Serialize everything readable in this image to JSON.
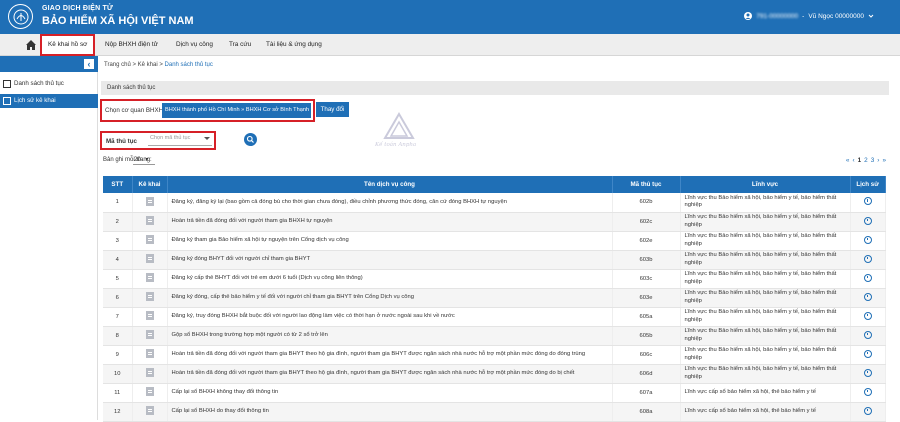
{
  "header": {
    "brand_line1": "GIAO DỊCH ĐIỆN TỬ",
    "brand_line2": "BẢO HIỂM XÃ HỘI VIỆT NAM",
    "user_code": "791-00000000",
    "user_name": "Vũ Ngọc 00000000"
  },
  "nav": {
    "items": [
      {
        "label": "Kê khai hồ sơ"
      },
      {
        "label": "Nộp BHXH điện tử"
      },
      {
        "label": "Dịch vụ công"
      },
      {
        "label": "Tra cứu"
      },
      {
        "label": "Tài liệu & ứng dụng"
      }
    ]
  },
  "sidebar": {
    "items": [
      {
        "label": "Danh sách thủ tục"
      },
      {
        "label": "Lịch sử kê khai"
      }
    ]
  },
  "breadcrumb": {
    "home": "Trang chủ",
    "sep": ">",
    "level1": "Kê khai",
    "current": "Danh sách thủ tục"
  },
  "section_title": "Danh sách thủ tục",
  "filters": {
    "agency_label": "Chọn cơ quan BHXH",
    "agency_value": "BHXH thành phố Hồ Chí Minh » BHXH Cơ sở Bình Thạnh",
    "change_button": "Thay đổi",
    "code_label": "Mã thủ tục",
    "code_placeholder": "Chọn mã thủ tục"
  },
  "watermark_text": "Kế toán Anpha",
  "paging": {
    "page_size_label": "Bản ghi mỗi trang:",
    "page_size": "20",
    "first": "«",
    "prev": "‹",
    "pages": [
      "1",
      "2",
      "3"
    ],
    "next": "›",
    "last": "»"
  },
  "table": {
    "headers": {
      "stt": "STT",
      "kekhai": "Kê khai",
      "name": "Tên dịch vụ công",
      "code": "Mã thủ tục",
      "field": "Lĩnh vực",
      "history": "Lịch sử"
    },
    "rows": [
      {
        "stt": "1",
        "name": "Đăng ký, đăng ký lại (bao gồm cả đóng bù cho thời gian chưa đóng), điều chỉnh phương thức đóng, căn cứ đóng BHXH tự nguyện",
        "code": "602b",
        "field": "Lĩnh vực thu Bảo hiểm xã hội, bảo hiểm y tế, bảo hiểm thất nghiệp"
      },
      {
        "stt": "2",
        "name": "Hoàn trả tiền đã đóng đối với người tham gia BHXH tự nguyện",
        "code": "602c",
        "field": "Lĩnh vực thu Bảo hiểm xã hội, bảo hiểm y tế, bảo hiểm thất nghiệp"
      },
      {
        "stt": "3",
        "name": "Đăng ký tham gia Bảo hiểm xã hội tự nguyện trên Cổng dịch vụ công",
        "code": "602e",
        "field": "Lĩnh vực thu Bảo hiểm xã hội, bảo hiểm y tế, bảo hiểm thất nghiệp"
      },
      {
        "stt": "4",
        "name": "Đăng ký đóng BHYT đối với người chỉ tham gia BHYT",
        "code": "603b",
        "field": "Lĩnh vực thu Bảo hiểm xã hội, bảo hiểm y tế, bảo hiểm thất nghiệp"
      },
      {
        "stt": "5",
        "name": "Đăng ký cấp thẻ BHYT đối với trẻ em dưới 6 tuổi (Dịch vụ công liên thông)",
        "code": "603c",
        "field": "Lĩnh vực thu Bảo hiểm xã hội, bảo hiểm y tế, bảo hiểm thất nghiệp"
      },
      {
        "stt": "6",
        "name": "Đăng ký đóng, cấp thẻ bảo hiểm y tế đối với người chỉ tham gia BHYT trên Cổng Dịch vụ công",
        "code": "603e",
        "field": "Lĩnh vực thu Bảo hiểm xã hội, bảo hiểm y tế, bảo hiểm thất nghiệp"
      },
      {
        "stt": "7",
        "name": "Đăng ký, truy đóng BHXH bắt buộc đối với người lao động làm việc có thời hạn ở nước ngoài sau khi về nước",
        "code": "605a",
        "field": "Lĩnh vực thu Bảo hiểm xã hội, bảo hiểm y tế, bảo hiểm thất nghiệp"
      },
      {
        "stt": "8",
        "name": "Gộp sổ BHXH trong trường hợp một người có từ 2 sổ trở lên",
        "code": "605b",
        "field": "Lĩnh vực thu Bảo hiểm xã hội, bảo hiểm y tế, bảo hiểm thất nghiệp"
      },
      {
        "stt": "9",
        "name": "Hoàn trả tiền đã đóng đối với người tham gia BHYT theo hộ gia đình, người tham gia BHYT được ngân sách nhà nước hỗ trợ một phần mức đóng do đóng trùng",
        "code": "606c",
        "field": "Lĩnh vực thu Bảo hiểm xã hội, bảo hiểm y tế, bảo hiểm thất nghiệp"
      },
      {
        "stt": "10",
        "name": "Hoàn trả tiền đã đóng đối với người tham gia BHYT theo hộ gia đình, người tham gia BHYT được ngân sách nhà nước hỗ trợ một phần mức đóng do bị chết",
        "code": "606d",
        "field": "Lĩnh vực thu Bảo hiểm xã hội, bảo hiểm y tế, bảo hiểm thất nghiệp"
      },
      {
        "stt": "11",
        "name": "Cấp lại sổ BHXH không thay đổi thông tin",
        "code": "607a",
        "field": "Lĩnh vực cấp sổ bảo hiểm xã hội, thẻ bảo hiểm y tế"
      },
      {
        "stt": "12",
        "name": "Cấp lại sổ BHXH do thay đổi thông tin",
        "code": "608a",
        "field": "Lĩnh vực cấp sổ bảo hiểm xã hội, thẻ bảo hiểm y tế"
      }
    ]
  },
  "colors": {
    "primary": "#1f6fb6",
    "highlight": "#d62027"
  }
}
